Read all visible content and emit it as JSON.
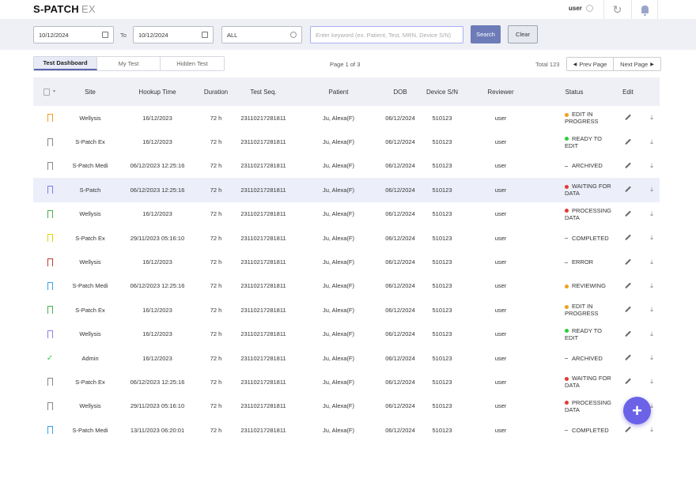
{
  "header": {
    "logo": "S-PATCH",
    "logo_suffix": "EX",
    "user": "user"
  },
  "filters": {
    "date_from": "10/12/2024",
    "to_label": "To",
    "date_to": "10/12/2024",
    "status_select": "ALL",
    "search_placeholder": "Enter keyword (ex. Patient, Test, MRN, Device S/N)",
    "search_label": "Search",
    "clear_label": "Clear"
  },
  "tabs": [
    {
      "label": "Test Dashboard",
      "active": true
    },
    {
      "label": "My Test",
      "active": false
    },
    {
      "label": "Hidden Test",
      "active": false
    }
  ],
  "pagination": {
    "page_info": "Page 1 of 3",
    "total": "Total 123",
    "prev_label": "Prev Page",
    "next_label": "Next Page"
  },
  "table": {
    "columns": [
      "Site",
      "Hookup Time",
      "Duration",
      "Test Seq.",
      "Patient",
      "DOB",
      "Device S/N",
      "Reviewer",
      "Status",
      "Edit"
    ],
    "rows": [
      {
        "icon": "bookmark",
        "icon_color": "#f0a020",
        "site": "Wellysis",
        "hookup": "16/12/2023",
        "duration": "72 h",
        "seq": "23110217281811",
        "patient": "Ju, Alexa(F)",
        "dob": "06/12/2024",
        "device": "510123",
        "reviewer": "user",
        "status": "EDIT IN PROGRESS",
        "status_color": "#f0a020",
        "selected": false
      },
      {
        "icon": "bookmark",
        "icon_color": "#888888",
        "site": "S-Patch Ex",
        "hookup": "16/12/2023",
        "duration": "72 h",
        "seq": "23110217281811",
        "patient": "Ju, Alexa(F)",
        "dob": "06/12/2024",
        "device": "510123",
        "reviewer": "user",
        "status": "READY TO EDIT",
        "status_color": "#2ecc40",
        "selected": false
      },
      {
        "icon": "bookmark",
        "icon_color": "#888888",
        "site": "S-Patch Medi",
        "hookup": "06/12/2023 12:25:16",
        "duration": "72 h",
        "seq": "23110217281811",
        "patient": "Ju, Alexa(F)",
        "dob": "06/12/2024",
        "device": "510123",
        "reviewer": "user",
        "status": "ARCHIVED",
        "status_color": "",
        "selected": false
      },
      {
        "icon": "bookmark",
        "icon_color": "#7b7fe8",
        "site": "S-Patch",
        "hookup": "06/12/2023 12:25:16",
        "duration": "72 h",
        "seq": "23110217281811",
        "patient": "Ju, Alexa(F)",
        "dob": "06/12/2024",
        "device": "510123",
        "reviewer": "user",
        "status": "WAITING FOR DATA",
        "status_color": "#e53935",
        "selected": true
      },
      {
        "icon": "bookmark",
        "icon_color": "#4caf50",
        "site": "Wellysis",
        "hookup": "16/12/2023",
        "duration": "72 h",
        "seq": "23110217281811",
        "patient": "Ju, Alexa(F)",
        "dob": "06/12/2024",
        "device": "510123",
        "reviewer": "user",
        "status": "PROCESSING DATA",
        "status_color": "#e53935",
        "selected": false
      },
      {
        "icon": "bookmark",
        "icon_color": "#e6d200",
        "site": "S-Patch Ex",
        "hookup": "29/11/2023 05:16:10",
        "duration": "72 h",
        "seq": "23110217281811",
        "patient": "Ju, Alexa(F)",
        "dob": "06/12/2024",
        "device": "510123",
        "reviewer": "user",
        "status": "COMPLETED",
        "status_color": "",
        "selected": false
      },
      {
        "icon": "bookmark",
        "icon_color": "#c0392b",
        "site": "Wellysis",
        "hookup": "16/12/2023",
        "duration": "72 h",
        "seq": "23110217281811",
        "patient": "Ju, Alexa(F)",
        "dob": "06/12/2024",
        "device": "510123",
        "reviewer": "user",
        "status": "ERROR",
        "status_color": "",
        "selected": false
      },
      {
        "icon": "bookmark",
        "icon_color": "#3aa0e8",
        "site": "S-Patch Medi",
        "hookup": "06/12/2023 12:25:16",
        "duration": "72 h",
        "seq": "23110217281811",
        "patient": "Ju, Alexa(F)",
        "dob": "06/12/2024",
        "device": "510123",
        "reviewer": "user",
        "status": "REVIEWING",
        "status_color": "#f0a020",
        "selected": false
      },
      {
        "icon": "bookmark",
        "icon_color": "#4caf50",
        "site": "S-Patch Ex",
        "hookup": "16/12/2023",
        "duration": "72 h",
        "seq": "23110217281811",
        "patient": "Ju, Alexa(F)",
        "dob": "06/12/2024",
        "device": "510123",
        "reviewer": "user",
        "status": "EDIT IN PROGRESS",
        "status_color": "#f0a020",
        "selected": false
      },
      {
        "icon": "bookmark",
        "icon_color": "#8a7fe8",
        "site": "Wellysis",
        "hookup": "16/12/2023",
        "duration": "72 h",
        "seq": "23110217281811",
        "patient": "Ju, Alexa(F)",
        "dob": "06/12/2024",
        "device": "510123",
        "reviewer": "user",
        "status": "READY TO EDIT",
        "status_color": "#2ecc40",
        "selected": false
      },
      {
        "icon": "check",
        "icon_color": "#2ecc40",
        "site": "Admin",
        "hookup": "16/12/2023",
        "duration": "72 h",
        "seq": "23110217281811",
        "patient": "Ju, Alexa(F)",
        "dob": "06/12/2024",
        "device": "510123",
        "reviewer": "user",
        "status": "ARCHIVED",
        "status_color": "",
        "selected": false
      },
      {
        "icon": "bookmark",
        "icon_color": "#888888",
        "site": "S-Patch Ex",
        "hookup": "06/12/2023 12:25:16",
        "duration": "72 h",
        "seq": "23110217281811",
        "patient": "Ju, Alexa(F)",
        "dob": "06/12/2024",
        "device": "510123",
        "reviewer": "user",
        "status": "WAITING FOR DATA",
        "status_color": "#e53935",
        "selected": false
      },
      {
        "icon": "bookmark",
        "icon_color": "#888888",
        "site": "Wellysis",
        "hookup": "29/11/2023 05:16:10",
        "duration": "72 h",
        "seq": "23110217281811",
        "patient": "Ju, Alexa(F)",
        "dob": "06/12/2024",
        "device": "510123",
        "reviewer": "user",
        "status": "PROCESSING DATA",
        "status_color": "#e53935",
        "selected": false
      },
      {
        "icon": "bookmark",
        "icon_color": "#3aa0e8",
        "site": "S-Patch Medi",
        "hookup": "13/11/2023 06:20:01",
        "duration": "72 h",
        "seq": "23110217281811",
        "patient": "Ju, Alexa(F)",
        "dob": "06/12/2024",
        "device": "510123",
        "reviewer": "user",
        "status": "COMPLETED",
        "status_color": "",
        "selected": false
      }
    ]
  },
  "fab": {
    "icon": "plus-icon",
    "color": "#6b62e8"
  }
}
